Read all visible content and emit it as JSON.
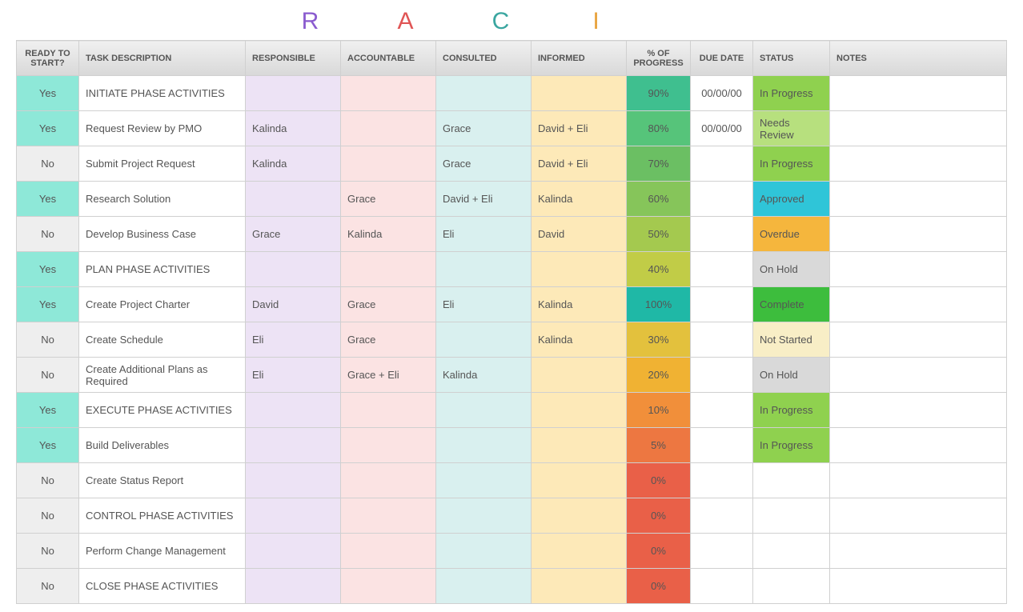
{
  "raci_letters": [
    {
      "letter": "R",
      "color": "#8a5bcf"
    },
    {
      "letter": "A",
      "color": "#e05555"
    },
    {
      "letter": "C",
      "color": "#3aa6a0"
    },
    {
      "letter": "I",
      "color": "#e8a33d"
    }
  ],
  "columns": {
    "ready": "READY TO START?",
    "task": "TASK DESCRIPTION",
    "responsible": "RESPONSIBLE",
    "accountable": "ACCOUNTABLE",
    "consulted": "CONSULTED",
    "informed": "INFORMED",
    "progress": "% of PROGRESS",
    "due": "DUE DATE",
    "status": "STATUS",
    "notes": "NOTES"
  },
  "rows": [
    {
      "ready": "Yes",
      "task": "INITIATE PHASE ACTIVITIES",
      "responsible": "",
      "accountable": "",
      "consulted": "",
      "informed": "",
      "progress": "90%",
      "progress_bg": "#3fbf8f",
      "due": "00/00/00",
      "status": "In Progress",
      "status_bg": "#8fd14f",
      "notes": ""
    },
    {
      "ready": "Yes",
      "task": "Request Review by PMO",
      "responsible": "Kalinda",
      "accountable": "",
      "consulted": "Grace",
      "informed": "David + Eli",
      "progress": "80%",
      "progress_bg": "#56c47a",
      "due": "00/00/00",
      "status": "Needs Review",
      "status_bg": "#b7e07e",
      "notes": ""
    },
    {
      "ready": "No",
      "task": "Submit Project Request",
      "responsible": "Kalinda",
      "accountable": "",
      "consulted": "Grace",
      "informed": "David + Eli",
      "progress": "70%",
      "progress_bg": "#6bbf63",
      "due": "",
      "status": "In Progress",
      "status_bg": "#8fd14f",
      "notes": ""
    },
    {
      "ready": "Yes",
      "task": "Research Solution",
      "responsible": "",
      "accountable": "Grace",
      "consulted": "David + Eli",
      "informed": "Kalinda",
      "progress": "60%",
      "progress_bg": "#86c55a",
      "due": "",
      "status": "Approved",
      "status_bg": "#2fc5d8",
      "notes": ""
    },
    {
      "ready": "No",
      "task": "Develop Business Case",
      "responsible": "Grace",
      "accountable": "Kalinda",
      "consulted": "Eli",
      "informed": "David",
      "progress": "50%",
      "progress_bg": "#a4c94f",
      "due": "",
      "status": "Overdue",
      "status_bg": "#f5b63d",
      "notes": ""
    },
    {
      "ready": "Yes",
      "task": "PLAN PHASE ACTIVITIES",
      "responsible": "",
      "accountable": "",
      "consulted": "",
      "informed": "",
      "progress": "40%",
      "progress_bg": "#c1cc47",
      "due": "",
      "status": "On Hold",
      "status_bg": "#d9d9d9",
      "notes": ""
    },
    {
      "ready": "Yes",
      "task": "Create Project Charter",
      "responsible": "David",
      "accountable": "Grace",
      "consulted": "Eli",
      "informed": "Kalinda",
      "progress": "100%",
      "progress_bg": "#1fb8a6",
      "due": "",
      "status": "Complete",
      "status_bg": "#3dbd3d",
      "notes": ""
    },
    {
      "ready": "No",
      "task": "Create Schedule",
      "responsible": "Eli",
      "accountable": "Grace",
      "consulted": "",
      "informed": "Kalinda",
      "progress": "30%",
      "progress_bg": "#e3c13d",
      "due": "",
      "status": "Not Started",
      "status_bg": "#f8eec6",
      "notes": ""
    },
    {
      "ready": "No",
      "task": "Create Additional Plans as Required",
      "responsible": "Eli",
      "accountable": "Grace + Eli",
      "consulted": "Kalinda",
      "informed": "",
      "progress": "20%",
      "progress_bg": "#f0b233",
      "due": "",
      "status": "On Hold",
      "status_bg": "#d9d9d9",
      "notes": ""
    },
    {
      "ready": "Yes",
      "task": "EXECUTE PHASE ACTIVITIES",
      "responsible": "",
      "accountable": "",
      "consulted": "",
      "informed": "",
      "progress": "10%",
      "progress_bg": "#f18f3a",
      "due": "",
      "status": "In Progress",
      "status_bg": "#8fd14f",
      "notes": ""
    },
    {
      "ready": "Yes",
      "task": "Build Deliverables",
      "responsible": "",
      "accountable": "",
      "consulted": "",
      "informed": "",
      "progress": "5%",
      "progress_bg": "#ed7741",
      "due": "",
      "status": "In Progress",
      "status_bg": "#8fd14f",
      "notes": ""
    },
    {
      "ready": "No",
      "task": "Create Status Report",
      "responsible": "",
      "accountable": "",
      "consulted": "",
      "informed": "",
      "progress": "0%",
      "progress_bg": "#e96048",
      "due": "",
      "status": "",
      "status_bg": "",
      "notes": ""
    },
    {
      "ready": "No",
      "task": "CONTROL PHASE ACTIVITIES",
      "responsible": "",
      "accountable": "",
      "consulted": "",
      "informed": "",
      "progress": "0%",
      "progress_bg": "#e96048",
      "due": "",
      "status": "",
      "status_bg": "",
      "notes": ""
    },
    {
      "ready": "No",
      "task": "Perform Change Management",
      "responsible": "",
      "accountable": "",
      "consulted": "",
      "informed": "",
      "progress": "0%",
      "progress_bg": "#e96048",
      "due": "",
      "status": "",
      "status_bg": "",
      "notes": ""
    },
    {
      "ready": "No",
      "task": "CLOSE PHASE ACTIVITIES",
      "responsible": "",
      "accountable": "",
      "consulted": "",
      "informed": "",
      "progress": "0%",
      "progress_bg": "#e96048",
      "due": "",
      "status": "",
      "status_bg": "",
      "notes": ""
    }
  ]
}
